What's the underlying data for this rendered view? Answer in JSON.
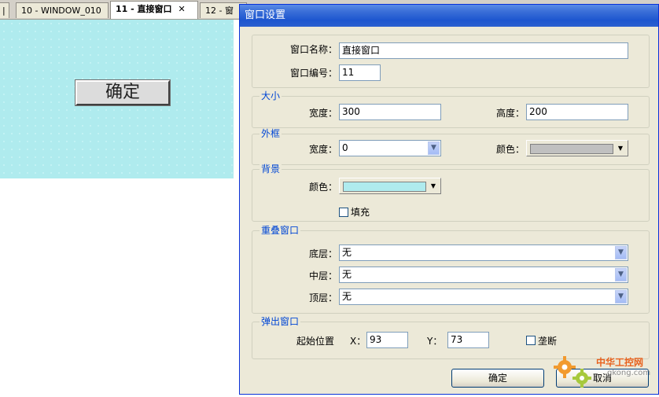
{
  "tabs": [
    {
      "label": "10 - WINDOW_010",
      "active": false
    },
    {
      "label": "11 - 直接窗口",
      "active": true,
      "close": "✕"
    },
    {
      "label": "12 - 窗",
      "active": false
    }
  ],
  "canvas": {
    "button_label": "确定",
    "background": "#afebee"
  },
  "dialog": {
    "title": "窗口设置",
    "general": {
      "name_label": "窗口名称：",
      "name_value": "直接窗口",
      "number_label": "窗口编号：",
      "number_value": "11"
    },
    "size": {
      "title": "大小",
      "width_label": "宽度：",
      "width_value": "300",
      "height_label": "高度：",
      "height_value": "200"
    },
    "frame": {
      "title": "外框",
      "width_label": "宽度：",
      "width_value": "0",
      "color_label": "颜色：",
      "color": "#c0c0c0"
    },
    "background": {
      "title": "背景",
      "color_label": "颜色：",
      "color": "#afebee",
      "fill_label": "填充",
      "fill_checked": false
    },
    "overlap": {
      "title": "重叠窗口",
      "bottom_label": "底层：",
      "bottom_value": "无",
      "middle_label": "中层：",
      "middle_value": "无",
      "top_label": "顶层：",
      "top_value": "无"
    },
    "popup": {
      "title": "弹出窗口",
      "start_label": "起始位置",
      "x_label": "X：",
      "x_value": "93",
      "y_label": "Y：",
      "y_value": "73",
      "modal_label": "垄断",
      "modal_checked": false
    },
    "ok_label": "确定",
    "cancel_label": "取消"
  },
  "watermark": {
    "text": "中华工控网",
    "url": "gkong.com"
  }
}
